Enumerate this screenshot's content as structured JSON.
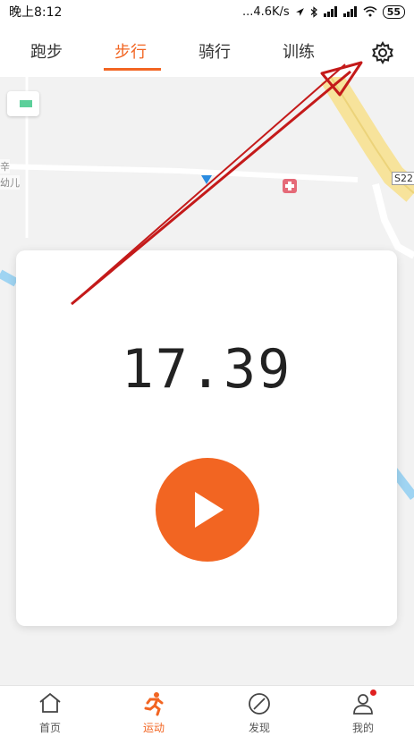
{
  "status_bar": {
    "time": "晚上8:12",
    "network_speed": "...4.6K/s",
    "battery": "55"
  },
  "tabs": [
    {
      "label": "跑步",
      "active": false
    },
    {
      "label": "步行",
      "active": true
    },
    {
      "label": "骑行",
      "active": false
    },
    {
      "label": "训练",
      "active": false
    }
  ],
  "map": {
    "location_label": "",
    "road_badge": "S22",
    "place_labels": [
      "辛",
      "幼儿"
    ]
  },
  "card": {
    "distance": "17.39",
    "play_icon": "play-icon"
  },
  "bottom_nav": [
    {
      "label": "首页",
      "icon": "home-icon",
      "active": false
    },
    {
      "label": "运动",
      "icon": "runner-icon",
      "active": true
    },
    {
      "label": "发现",
      "icon": "compass-icon",
      "active": false
    },
    {
      "label": "我的",
      "icon": "user-icon",
      "active": false,
      "badge": true
    }
  ],
  "colors": {
    "accent": "#f26522",
    "annotation_arrow": "#c41a1a"
  }
}
